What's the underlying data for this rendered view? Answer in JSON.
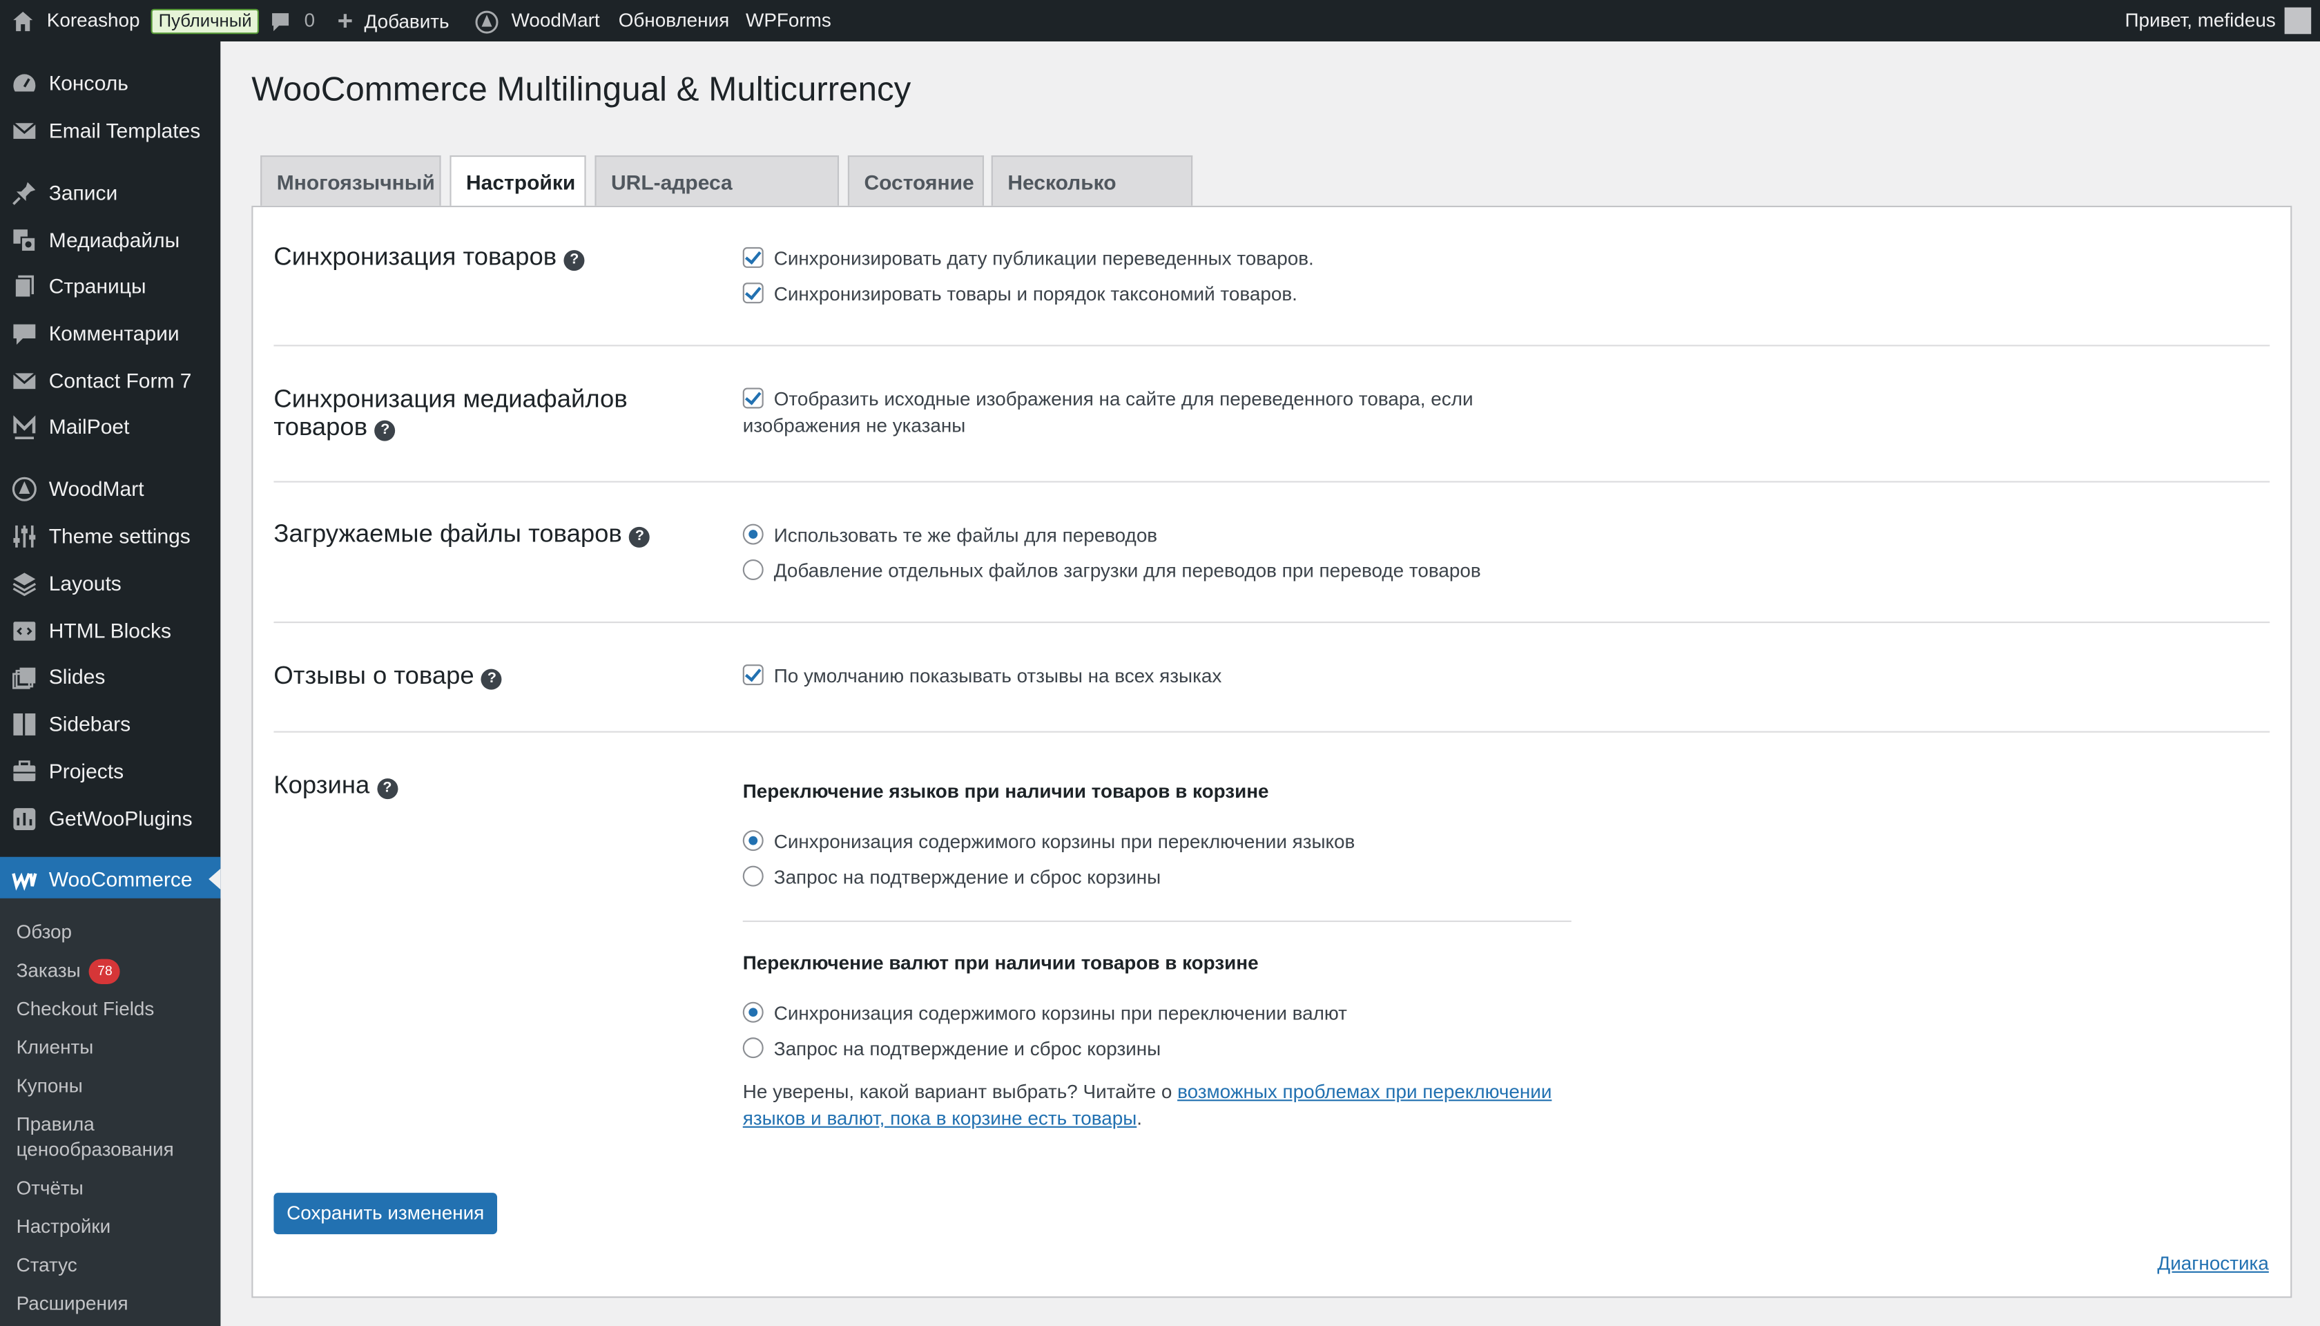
{
  "admin_bar": {
    "site_name": "Koreashop",
    "public_badge": "Публичный",
    "comments_count": "0",
    "add_new": "Добавить",
    "woodmart": "WoodMart",
    "updates": "Обновления",
    "wpforms": "WPForms",
    "greeting": "Привет, mefideus"
  },
  "sidebar": {
    "items": [
      {
        "label": "Консоль",
        "icon": "dashboard-icon"
      },
      {
        "label": "Email Templates",
        "icon": "email-icon"
      },
      {
        "label": "Записи",
        "icon": "pin-icon"
      },
      {
        "label": "Медиафайлы",
        "icon": "media-icon"
      },
      {
        "label": "Страницы",
        "icon": "pages-icon"
      },
      {
        "label": "Комментарии",
        "icon": "comment-icon"
      },
      {
        "label": "Contact Form 7",
        "icon": "email-icon"
      },
      {
        "label": "MailPoet",
        "icon": "mailpoet-icon"
      },
      {
        "label": "WoodMart",
        "icon": "woodmart-icon"
      },
      {
        "label": "Theme settings",
        "icon": "sliders-icon"
      },
      {
        "label": "Layouts",
        "icon": "layers-icon"
      },
      {
        "label": "HTML Blocks",
        "icon": "code-icon"
      },
      {
        "label": "Slides",
        "icon": "slides-icon"
      },
      {
        "label": "Sidebars",
        "icon": "sidebar-icon"
      },
      {
        "label": "Projects",
        "icon": "briefcase-icon"
      },
      {
        "label": "GetWooPlugins",
        "icon": "plugin-icon"
      },
      {
        "label": "WooCommerce",
        "icon": "woocommerce-icon"
      }
    ],
    "submenu": [
      {
        "label": "Обзор"
      },
      {
        "label": "Заказы",
        "count": "78"
      },
      {
        "label": "Checkout Fields"
      },
      {
        "label": "Клиенты"
      },
      {
        "label": "Купоны"
      },
      {
        "label": "Правила ценообразования"
      },
      {
        "label": "Отчёты"
      },
      {
        "label": "Настройки"
      },
      {
        "label": "Статус"
      },
      {
        "label": "Расширения"
      }
    ]
  },
  "page": {
    "title": "WooCommerce Multilingual & Multicurrency",
    "tabs": [
      "Многоязычный",
      "Настройки",
      "URL-адреса магазина",
      "Состояние",
      "Несколько валют"
    ],
    "active_tab": "Настройки"
  },
  "sections": {
    "product_sync": {
      "title": "Синхронизация товаров",
      "options": [
        {
          "label": "Синхронизировать дату публикации переведенных товаров.",
          "checked": true
        },
        {
          "label": "Синхронизировать товары и порядок таксономий товаров.",
          "checked": true
        }
      ]
    },
    "media_sync": {
      "title_line1": "Синхронизация медиафайлов",
      "title_line2": "товаров",
      "option_line1": "Отобразить исходные изображения на сайте для переведенного товара, если",
      "option_line2": "изображения не указаны",
      "checked": true
    },
    "downloads": {
      "title": "Загружаемые файлы товаров",
      "options": [
        {
          "label": "Использовать те же файлы для переводов",
          "selected": true
        },
        {
          "label": "Добавление отдельных файлов загрузки для переводов при переводе товаров",
          "selected": false
        }
      ]
    },
    "reviews": {
      "title": "Отзывы о товаре",
      "option": "По умолчанию показывать отзывы на всех языках",
      "checked": true
    },
    "cart": {
      "title": "Корзина",
      "lang_heading": "Переключение языков при наличии товаров в корзине",
      "lang_options": [
        {
          "label": "Синхронизация содержимого корзины при переключении языков",
          "selected": true
        },
        {
          "label": "Запрос на подтверждение и сброс корзины",
          "selected": false
        }
      ],
      "currency_heading": "Переключение валют при наличии товаров в корзине",
      "currency_options": [
        {
          "label": "Синхронизация содержимого корзины при переключении валют",
          "selected": true
        },
        {
          "label": "Запрос на подтверждение и сброс корзины",
          "selected": false
        }
      ],
      "note_prefix": "Не уверены, какой вариант выбрать? Читайте о ",
      "note_link_line1": "возможных проблемах при переключении",
      "note_link_line2": "языков и валют, пока в корзине есть товары",
      "note_suffix": "."
    }
  },
  "actions": {
    "save": "Сохранить изменения",
    "diagnostics": "Диагностика"
  },
  "colors": {
    "admin_dark": "#1d2327",
    "accent": "#2271b1",
    "badge_red": "#d63638"
  }
}
